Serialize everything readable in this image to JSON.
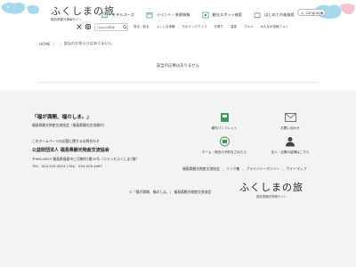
{
  "colors": {
    "accent": "#a7d9ee",
    "pink": "#f4c4cf",
    "footer_bg": "#f3f3f3",
    "green": "#3d9b57"
  },
  "header": {
    "logo": "ふくしまの旅",
    "logo_sub": "福島県観光情報サイト",
    "nav": [
      {
        "label": "モデルコース",
        "icon": "map-icon"
      },
      {
        "label": "イベント・季節情報",
        "icon": "calendar-icon"
      },
      {
        "label": "観光スポット検索",
        "icon": "spot-icon"
      },
      {
        "label": "はじめての福島県",
        "icon": "book-icon"
      }
    ],
    "language_label": "Language",
    "search_placeholder": "Google検索",
    "categories": [
      "見る・知る",
      "ふくしま体験",
      "ちのミックアップ",
      "お祭り",
      "温泉",
      "グルメ",
      "みんなの投稿フォト"
    ]
  },
  "breadcrumb": {
    "home": "HOME",
    "separator": "/",
    "current": "該当のお知らせはありません"
  },
  "main": {
    "message": "該当の記事はありません"
  },
  "footer": {
    "slogan": "「福が満開、福のしま。」",
    "association": "福島県観光物産交流協会（福島県観光交流課内）",
    "note": "このホームページの記載に関するお問合わせ",
    "org": "公益財団法人 福島県観光物産交流協会",
    "address": "〒960-8053 福島県福島市三河南町1番20号（コラッセふくしま7階）",
    "tel": "TEL：024-525-4024 / FAX：024-525-4087",
    "icons": [
      {
        "label": "観光パンフレット",
        "icon": "pamphlet-icon"
      },
      {
        "label": "お問い合わせ",
        "icon": "mail-icon"
      },
      {
        "label": "ホーム・宿泊の予約をされたら",
        "icon": "hotel-icon"
      },
      {
        "label": "法人・企業の皆様はこちら",
        "icon": "person-icon"
      }
    ],
    "links": [
      "福島県観光物産交流協会",
      "リンク集",
      "プライバシーポリシー",
      "サイトマップ"
    ],
    "copyright": "©「福が満開、福のしま。」 福島県観光物産交流協会",
    "logo": "ふくしまの旅",
    "logo_sub": "福島県観光情報サイト"
  }
}
